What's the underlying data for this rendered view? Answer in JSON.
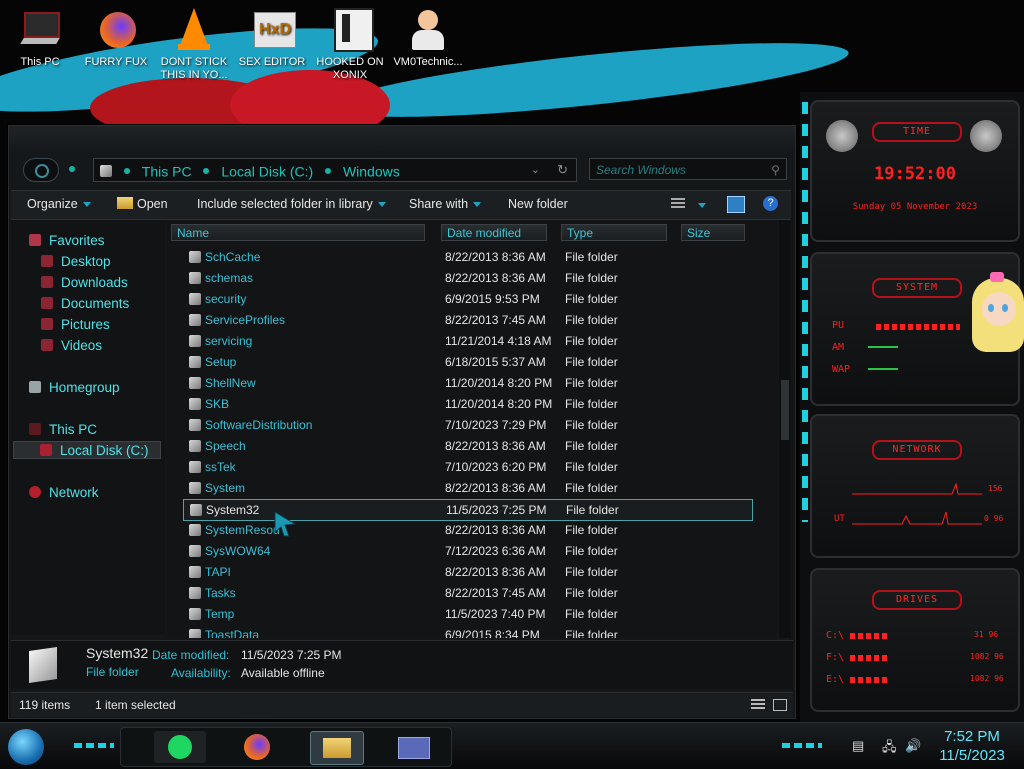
{
  "desktop": {
    "icons": [
      {
        "label": "This PC"
      },
      {
        "label": "FURRY FUX"
      },
      {
        "label": "DONT STICK THIS IN YO..."
      },
      {
        "label": "SEX EDITOR"
      },
      {
        "label": "HOOKED ON XONIX"
      },
      {
        "label": "VM0Technic..."
      }
    ]
  },
  "explorer": {
    "address": {
      "segments": [
        "This PC",
        "Local Disk (C:)",
        "Windows"
      ]
    },
    "search_placeholder": "Search Windows",
    "toolbar": {
      "organize": "Organize",
      "open": "Open",
      "include": "Include selected folder in library",
      "share": "Share with",
      "new_folder": "New folder"
    },
    "nav": {
      "favorites": "Favorites",
      "desktop": "Desktop",
      "downloads": "Downloads",
      "documents": "Documents",
      "pictures": "Pictures",
      "videos": "Videos",
      "homegroup": "Homegroup",
      "this_pc": "This PC",
      "local_disk": "Local Disk (C:)",
      "network": "Network"
    },
    "columns": {
      "name": "Name",
      "date": "Date modified",
      "type": "Type",
      "size": "Size"
    },
    "files": [
      {
        "name": "SchCache",
        "date": "8/22/2013 8:36 AM",
        "type": "File folder"
      },
      {
        "name": "schemas",
        "date": "8/22/2013 8:36 AM",
        "type": "File folder"
      },
      {
        "name": "security",
        "date": "6/9/2015 9:53 PM",
        "type": "File folder"
      },
      {
        "name": "ServiceProfiles",
        "date": "8/22/2013 7:45 AM",
        "type": "File folder"
      },
      {
        "name": "servicing",
        "date": "11/21/2014 4:18 AM",
        "type": "File folder"
      },
      {
        "name": "Setup",
        "date": "6/18/2015 5:37 AM",
        "type": "File folder"
      },
      {
        "name": "ShellNew",
        "date": "11/20/2014 8:20 PM",
        "type": "File folder"
      },
      {
        "name": "SKB",
        "date": "11/20/2014 8:20 PM",
        "type": "File folder"
      },
      {
        "name": "SoftwareDistribution",
        "date": "7/10/2023 7:29 PM",
        "type": "File folder"
      },
      {
        "name": "Speech",
        "date": "8/22/2013 8:36 AM",
        "type": "File folder"
      },
      {
        "name": "ssTek",
        "date": "7/10/2023 6:20 PM",
        "type": "File folder"
      },
      {
        "name": "System",
        "date": "8/22/2013 8:36 AM",
        "type": "File folder"
      },
      {
        "name": "System32",
        "date": "11/5/2023 7:25 PM",
        "type": "File folder"
      },
      {
        "name": "SystemResou",
        "date": "8/22/2013 8:36 AM",
        "type": "File folder"
      },
      {
        "name": "SysWOW64",
        "date": "7/12/2023 6:36 AM",
        "type": "File folder"
      },
      {
        "name": "TAPI",
        "date": "8/22/2013 8:36 AM",
        "type": "File folder"
      },
      {
        "name": "Tasks",
        "date": "8/22/2013 7:45 AM",
        "type": "File folder"
      },
      {
        "name": "Temp",
        "date": "11/5/2023 7:40 PM",
        "type": "File folder"
      },
      {
        "name": "ToastData",
        "date": "6/9/2015 8:34 PM",
        "type": "File folder"
      }
    ],
    "details": {
      "name": "System32",
      "kind": "File folder",
      "date_label": "Date modified:",
      "date_value": "11/5/2023 7:25 PM",
      "avail_label": "Availability:",
      "avail_value": "Available offline"
    },
    "status": {
      "items": "119 items",
      "selected": "1 item selected"
    }
  },
  "gadget": {
    "time_title": "TIME",
    "time": "19:52:00",
    "date": "Sunday 05 November 2023",
    "system_title": "SYSTEM",
    "cpu": "PU",
    "ram": "AM",
    "swap": "WAP",
    "network_title": "NETWORK",
    "net1": "156",
    "net1_prefix": "",
    "net2_prefix": "UT",
    "net2": "0 96",
    "drives_title": "DRIVES",
    "drives": [
      {
        "label": "C:\\",
        "value": "31 96"
      },
      {
        "label": "F:\\",
        "value": "1082 96"
      },
      {
        "label": "E:\\",
        "value": "1082 96"
      }
    ]
  },
  "taskbar": {
    "time": "7:52 PM",
    "date": "11/5/2023"
  },
  "colors": {
    "accent": "#1fc3bd",
    "gadget_red": "#ff2020",
    "wallpaper_blue": "#1fa3c6"
  }
}
